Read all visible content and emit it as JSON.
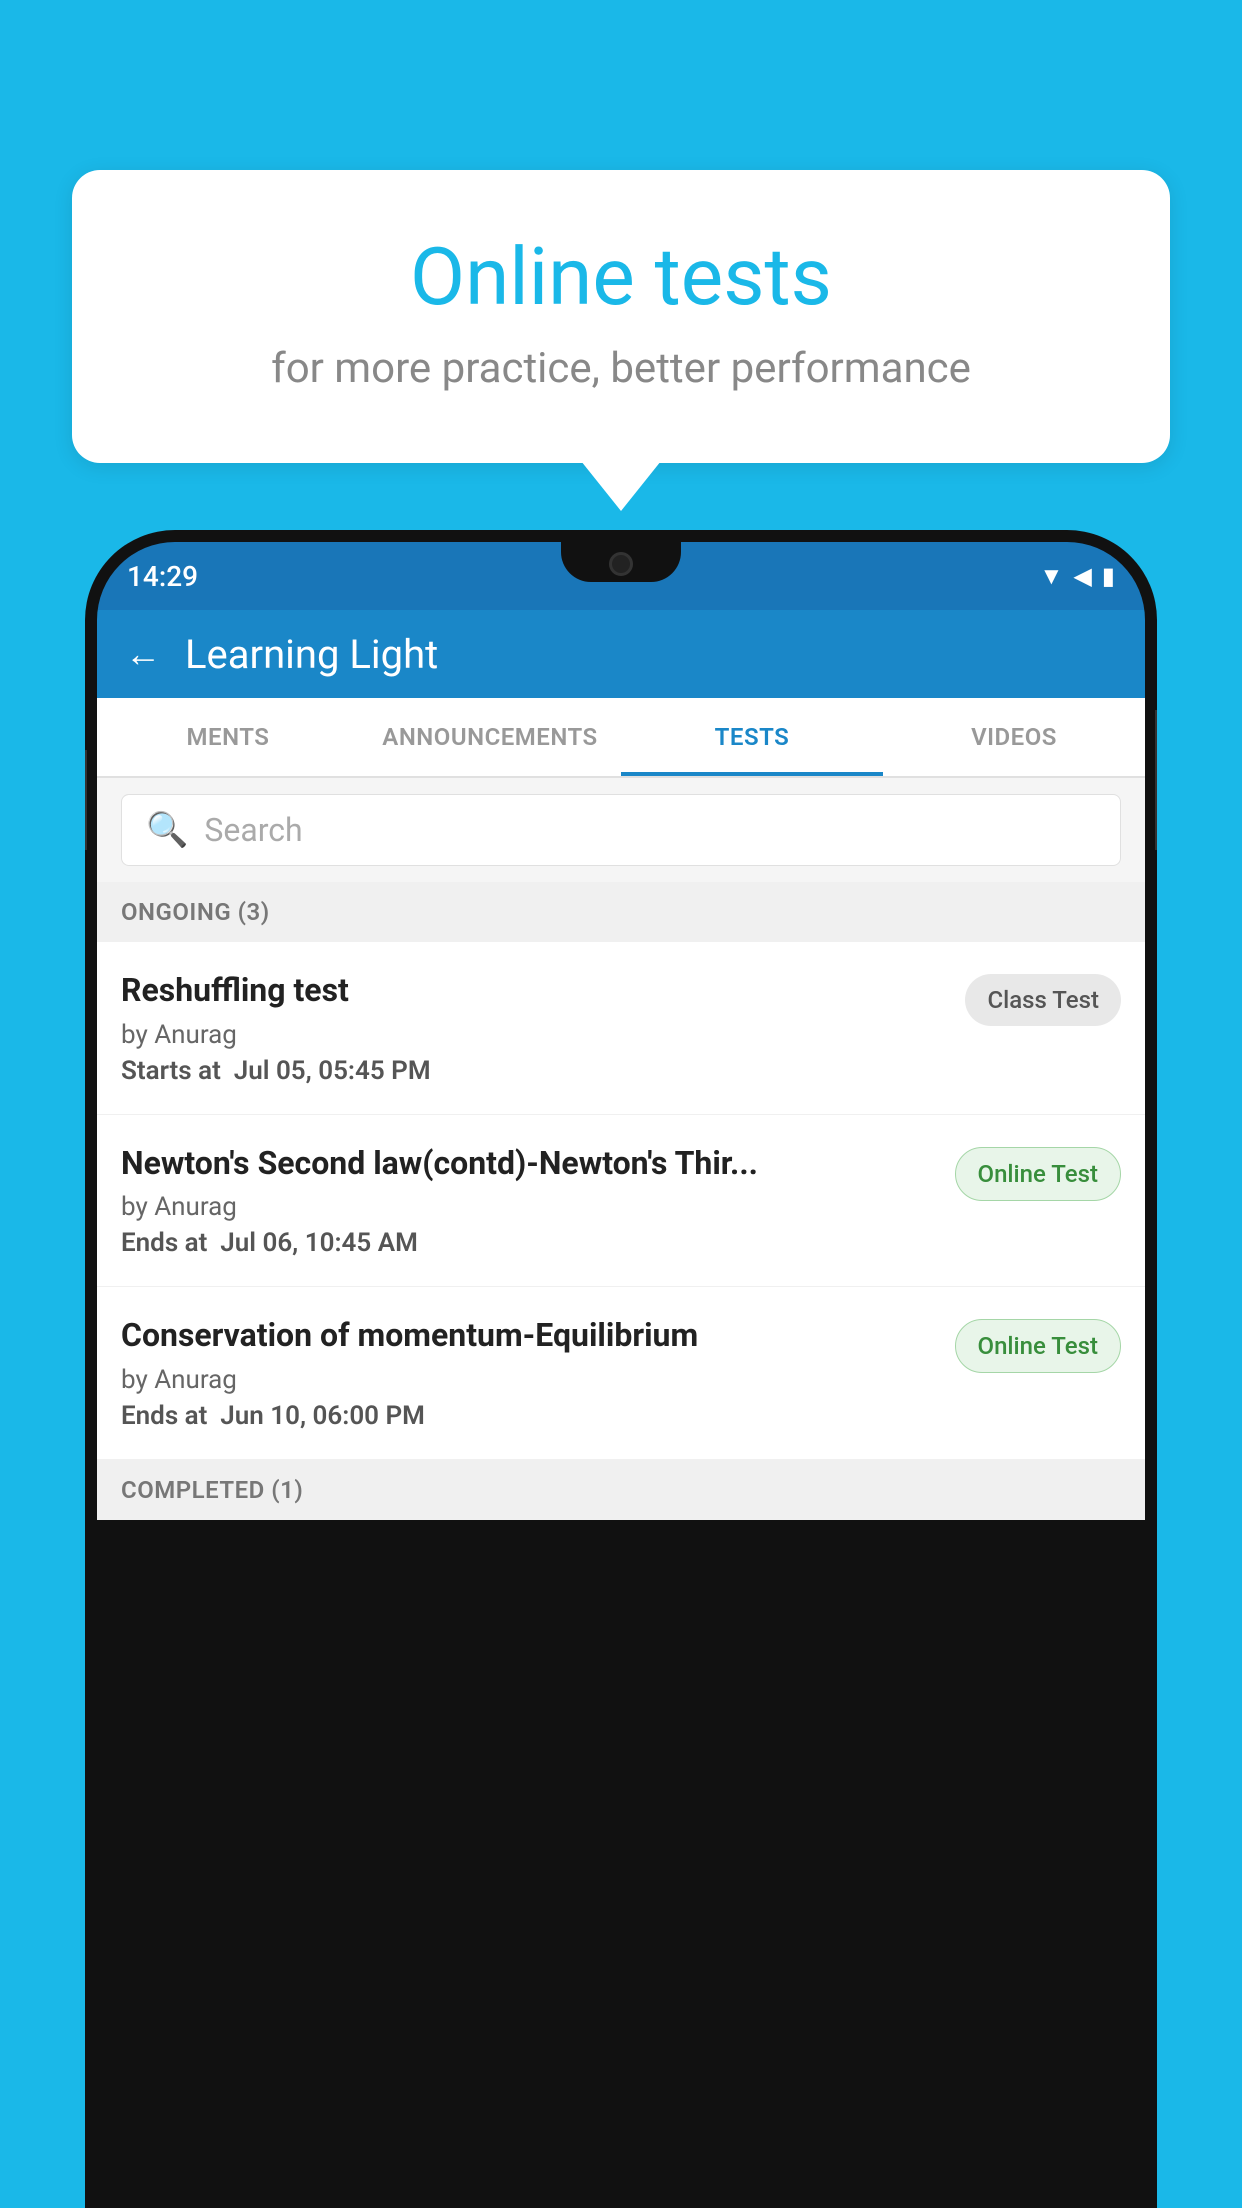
{
  "background_color": "#1ab8e8",
  "bubble": {
    "title": "Online tests",
    "subtitle": "for more practice, better performance"
  },
  "phone": {
    "status_bar": {
      "time": "14:29",
      "icons": "▼◀▮"
    },
    "app_bar": {
      "back_icon": "←",
      "title": "Learning Light"
    },
    "tabs": [
      {
        "label": "MENTS",
        "active": false
      },
      {
        "label": "ANNOUNCEMENTS",
        "active": false
      },
      {
        "label": "TESTS",
        "active": true
      },
      {
        "label": "VIDEOS",
        "active": false
      }
    ],
    "search": {
      "placeholder": "Search",
      "icon": "🔍"
    },
    "sections": [
      {
        "header": "ONGOING (3)",
        "items": [
          {
            "name": "Reshuffling test",
            "by": "by Anurag",
            "date_label": "Starts at",
            "date": "Jul 05, 05:45 PM",
            "badge": "Class Test",
            "badge_type": "class"
          },
          {
            "name": "Newton's Second law(contd)-Newton's Thir...",
            "by": "by Anurag",
            "date_label": "Ends at",
            "date": "Jul 06, 10:45 AM",
            "badge": "Online Test",
            "badge_type": "online"
          },
          {
            "name": "Conservation of momentum-Equilibrium",
            "by": "by Anurag",
            "date_label": "Ends at",
            "date": "Jun 10, 06:00 PM",
            "badge": "Online Test",
            "badge_type": "online"
          }
        ]
      }
    ],
    "completed_label": "COMPLETED (1)"
  }
}
